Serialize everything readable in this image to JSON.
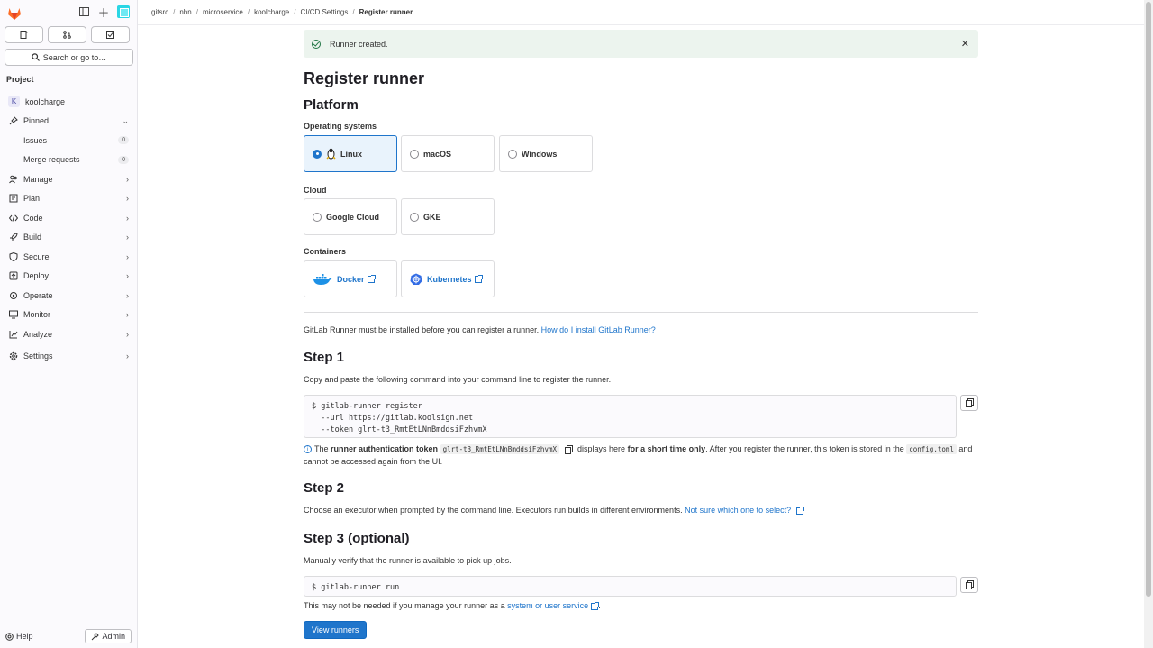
{
  "sidebar": {
    "search_placeholder": "Search or go to…",
    "section_title": "Project",
    "project": {
      "avatar_letter": "K",
      "name": "koolcharge"
    },
    "items": [
      {
        "label": "Pinned",
        "icon": "pin-icon"
      },
      {
        "label": "Issues",
        "badge": "0"
      },
      {
        "label": "Merge requests",
        "badge": "0"
      },
      {
        "label": "Manage",
        "icon": "users-icon"
      },
      {
        "label": "Plan",
        "icon": "planning-icon"
      },
      {
        "label": "Code",
        "icon": "code-icon"
      },
      {
        "label": "Build",
        "icon": "rocket-icon"
      },
      {
        "label": "Secure",
        "icon": "shield-icon"
      },
      {
        "label": "Deploy",
        "icon": "deployments-icon"
      },
      {
        "label": "Operate",
        "icon": "cloud-gear-icon"
      },
      {
        "label": "Monitor",
        "icon": "monitor-icon"
      },
      {
        "label": "Analyze",
        "icon": "chart-icon"
      },
      {
        "label": "Settings",
        "icon": "gear-icon"
      }
    ],
    "help_label": "Help",
    "admin_label": "Admin"
  },
  "breadcrumb": [
    "gitsrc",
    "nhn",
    "microservice",
    "koolcharge",
    "CI/CD Settings",
    "Register runner"
  ],
  "alert": {
    "text": "Runner created."
  },
  "page_title": "Register runner",
  "platform": {
    "heading": "Platform",
    "os_label": "Operating systems",
    "os": [
      "Linux",
      "macOS",
      "Windows"
    ],
    "cloud_label": "Cloud",
    "cloud": [
      "Google Cloud",
      "GKE"
    ],
    "containers_label": "Containers",
    "containers": [
      "Docker",
      "Kubernetes"
    ]
  },
  "install_note": {
    "text": "GitLab Runner must be installed before you can register a runner.",
    "link": "How do I install GitLab Runner?"
  },
  "step1": {
    "heading": "Step 1",
    "desc": "Copy and paste the following command into your command line to register the runner.",
    "code": "$ gitlab-runner register\n  --url https://gitlab.koolsign.net\n  --token glrt-t3_RmtEtLNnBmddsiFzhvmX",
    "info_pre": "The",
    "info_bold1": "runner authentication token",
    "info_token": "glrt-t3_RmtEtLNnBmddsiFzhvmX",
    "info_mid": "displays here",
    "info_bold2": "for a short time only",
    "info_post": ". After you register the runner, this token is stored in the",
    "info_file": "config.toml",
    "info_end": "and cannot be accessed again from the UI."
  },
  "step2": {
    "heading": "Step 2",
    "desc": "Choose an executor when prompted by the command line. Executors run builds in different environments.",
    "link": "Not sure which one to select?"
  },
  "step3": {
    "heading": "Step 3 (optional)",
    "desc": "Manually verify that the runner is available to pick up jobs.",
    "code": "$ gitlab-runner run",
    "note_pre": "This may not be needed if you manage your runner as a",
    "note_link": "system or user service",
    "note_end": "."
  },
  "view_runners_label": "View runners"
}
